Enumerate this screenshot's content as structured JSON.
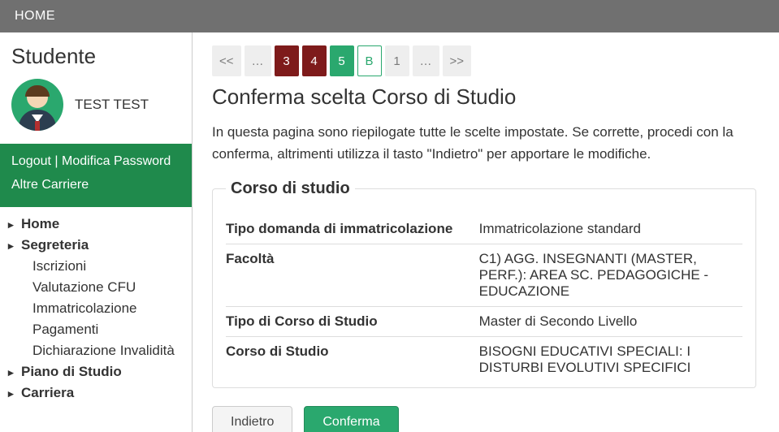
{
  "topbar": {
    "home": "HOME"
  },
  "sidebar": {
    "heading": "Studente",
    "user_name": "TEST TEST",
    "account": {
      "logout": "Logout",
      "change_password": "Modifica Password",
      "other_careers": "Altre Carriere"
    },
    "nav": {
      "home": "Home",
      "segreteria": "Segreteria",
      "iscrizioni": "Iscrizioni",
      "valutazione_cfu": "Valutazione CFU",
      "immatricolazione": "Immatricolazione",
      "pagamenti": "Pagamenti",
      "dichiarazione_invalidita": "Dichiarazione Invalidità",
      "piano_studio": "Piano di Studio",
      "carriera": "Carriera"
    }
  },
  "steps": {
    "first": "<<",
    "prev_e": "…",
    "s3": "3",
    "s4": "4",
    "s5": "5",
    "sB": "B",
    "s1": "1",
    "next_e": "…",
    "last": ">>"
  },
  "page": {
    "title": "Conferma scelta Corso di Studio",
    "description": "In questa pagina sono riepilogate tutte le scelte impostate. Se corrette, procedi con la conferma, altrimenti utilizza il tasto \"Indietro\" per apportare le modifiche."
  },
  "box": {
    "legend": "Corso di studio",
    "rows": [
      {
        "label": "Tipo domanda di immatricolazione",
        "value": "Immatricolazione standard"
      },
      {
        "label": "Facoltà",
        "value": "C1) AGG. INSEGNANTI (MASTER, PERF.): AREA SC. PEDAGOGICHE - EDUCAZIONE"
      },
      {
        "label": "Tipo di Corso di Studio",
        "value": "Master di Secondo Livello"
      },
      {
        "label": "Corso di Studio",
        "value": "BISOGNI EDUCATIVI SPECIALI: I DISTURBI EVOLUTIVI SPECIFICI"
      }
    ]
  },
  "buttons": {
    "back": "Indietro",
    "confirm": "Conferma"
  }
}
